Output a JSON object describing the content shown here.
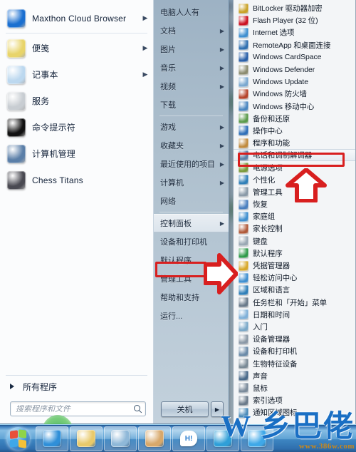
{
  "desktop": {
    "background_color": "#9db4c6"
  },
  "start_menu": {
    "pinned_programs": [
      {
        "label": "Maxthon Cloud Browser",
        "icon": "maxthon-icon",
        "has_submenu": true
      },
      {
        "label": "便笺",
        "icon": "sticky-notes-icon",
        "has_submenu": true
      },
      {
        "label": "记事本",
        "icon": "notepad-icon",
        "has_submenu": true
      },
      {
        "label": "服务",
        "icon": "services-icon",
        "has_submenu": false
      },
      {
        "label": "命令提示符",
        "icon": "command-prompt-icon",
        "has_submenu": false
      },
      {
        "label": "计算机管理",
        "icon": "computer-management-icon",
        "has_submenu": false
      },
      {
        "label": "Chess Titans",
        "icon": "chess-titans-icon",
        "has_submenu": false
      }
    ],
    "all_programs_label": "所有程序",
    "search": {
      "placeholder": "搜索程序和文件",
      "value": "",
      "icon": "search-icon"
    },
    "places": [
      {
        "label": "电脑人人有",
        "has_submenu": false,
        "highlight": false
      },
      {
        "label": "文档",
        "has_submenu": true,
        "highlight": false
      },
      {
        "label": "图片",
        "has_submenu": true,
        "highlight": false
      },
      {
        "label": "音乐",
        "has_submenu": true,
        "highlight": false
      },
      {
        "label": "视频",
        "has_submenu": true,
        "highlight": false
      },
      {
        "label": "下载",
        "has_submenu": false,
        "highlight": false
      },
      {
        "label": "游戏",
        "has_submenu": true,
        "highlight": false
      },
      {
        "label": "收藏夹",
        "has_submenu": true,
        "highlight": false
      },
      {
        "label": "最近使用的项目",
        "has_submenu": true,
        "highlight": false
      },
      {
        "label": "计算机",
        "has_submenu": true,
        "highlight": false
      },
      {
        "label": "网络",
        "has_submenu": false,
        "highlight": false
      },
      {
        "label": "控制面板",
        "has_submenu": true,
        "highlight": true
      },
      {
        "label": "设备和打印机",
        "has_submenu": false,
        "highlight": false
      },
      {
        "label": "默认程序",
        "has_submenu": false,
        "highlight": false
      },
      {
        "label": "管理工具",
        "has_submenu": true,
        "highlight": false
      },
      {
        "label": "帮助和支持",
        "has_submenu": false,
        "highlight": false
      },
      {
        "label": "运行...",
        "has_submenu": false,
        "highlight": false
      }
    ],
    "shutdown": {
      "label": "关机",
      "more_icon": "chevron-right-icon"
    }
  },
  "control_panel_submenu": {
    "items": [
      {
        "label": "BitLocker 驱动器加密",
        "icon": "bitlocker-icon",
        "icon_color": "#c9a227",
        "selected": false
      },
      {
        "label": "Flash Player (32 位)",
        "icon": "flash-player-icon",
        "icon_color": "#cc1122",
        "selected": false
      },
      {
        "label": "Internet 选项",
        "icon": "internet-options-icon",
        "icon_color": "#3f8fd0",
        "selected": false
      },
      {
        "label": "RemoteApp 和桌面连接",
        "icon": "remoteapp-icon",
        "icon_color": "#2f6fb0",
        "selected": false
      },
      {
        "label": "Windows CardSpace",
        "icon": "cardspace-icon",
        "icon_color": "#2a5fa8",
        "selected": false
      },
      {
        "label": "Windows Defender",
        "icon": "defender-icon",
        "icon_color": "#8c8c70",
        "selected": false
      },
      {
        "label": "Windows Update",
        "icon": "windows-update-icon",
        "icon_color": "#7aa8d0",
        "selected": false
      },
      {
        "label": "Windows 防火墙",
        "icon": "firewall-icon",
        "icon_color": "#b5432a",
        "selected": false
      },
      {
        "label": "Windows 移动中心",
        "icon": "mobility-center-icon",
        "icon_color": "#4a86c0",
        "selected": false
      },
      {
        "label": "备份和还原",
        "icon": "backup-restore-icon",
        "icon_color": "#5a9a4a",
        "selected": false
      },
      {
        "label": "操作中心",
        "icon": "action-center-icon",
        "icon_color": "#2f6fb8",
        "selected": false
      },
      {
        "label": "程序和功能",
        "icon": "programs-features-icon",
        "icon_color": "#c08a3e",
        "selected": false
      },
      {
        "label": "电话和调制解调器",
        "icon": "phone-modem-icon",
        "icon_color": "#5b7fa8",
        "selected": true
      },
      {
        "label": "电源选项",
        "icon": "power-options-icon",
        "icon_color": "#7a9a3a",
        "selected": false
      },
      {
        "label": "个性化",
        "icon": "personalization-icon",
        "icon_color": "#2f7fb8",
        "selected": false
      },
      {
        "label": "管理工具",
        "icon": "administrative-tools-icon",
        "icon_color": "#8a9aa8",
        "selected": false
      },
      {
        "label": "恢复",
        "icon": "recovery-icon",
        "icon_color": "#4a7fbf",
        "selected": false
      },
      {
        "label": "家庭组",
        "icon": "homegroup-icon",
        "icon_color": "#3f8fcf",
        "selected": false
      },
      {
        "label": "家长控制",
        "icon": "parental-controls-icon",
        "icon_color": "#b05a3a",
        "selected": false
      },
      {
        "label": "键盘",
        "icon": "keyboard-icon",
        "icon_color": "#9aa8b4",
        "selected": false
      },
      {
        "label": "默认程序",
        "icon": "default-programs-icon",
        "icon_color": "#2f9a4a",
        "selected": false
      },
      {
        "label": "凭据管理器",
        "icon": "credential-manager-icon",
        "icon_color": "#d8a82a",
        "selected": false
      },
      {
        "label": "轻松访问中心",
        "icon": "ease-of-access-icon",
        "icon_color": "#3f8fd0",
        "selected": false
      },
      {
        "label": "区域和语言",
        "icon": "region-language-icon",
        "icon_color": "#2f7fb8",
        "selected": false
      },
      {
        "label": "任务栏和「开始」菜单",
        "icon": "taskbar-startmenu-icon",
        "icon_color": "#6a7a8a",
        "selected": false
      },
      {
        "label": "日期和时间",
        "icon": "date-time-icon",
        "icon_color": "#7fb0d8",
        "selected": false
      },
      {
        "label": "入门",
        "icon": "getting-started-icon",
        "icon_color": "#7aa8c8",
        "selected": false
      },
      {
        "label": "设备管理器",
        "icon": "device-manager-icon",
        "icon_color": "#8a98a6",
        "selected": false
      },
      {
        "label": "设备和打印机",
        "icon": "devices-printers-icon",
        "icon_color": "#6a8aa8",
        "selected": false
      },
      {
        "label": "生物特征设备",
        "icon": "biometric-devices-icon",
        "icon_color": "#7a8a96",
        "selected": false
      },
      {
        "label": "声音",
        "icon": "sound-icon",
        "icon_color": "#4a6a8a",
        "selected": false
      },
      {
        "label": "鼠标",
        "icon": "mouse-icon",
        "icon_color": "#7a8a9a",
        "selected": false
      },
      {
        "label": "索引选项",
        "icon": "indexing-options-icon",
        "icon_color": "#6a7a8a",
        "selected": false
      },
      {
        "label": "通知区域图标",
        "icon": "notification-area-icon",
        "icon_color": "#4a8ab8",
        "selected": false
      }
    ]
  },
  "annotations": {
    "highlight_color": "#d81f1f",
    "boxes": [
      {
        "name": "phone-modem-highlight",
        "target": "电话和调制解调器"
      },
      {
        "name": "control-panel-highlight",
        "target": "控制面板"
      }
    ],
    "arrows": [
      {
        "name": "up-arrow-phone-modem",
        "direction": "up"
      },
      {
        "name": "right-arrow-control-panel",
        "direction": "right"
      }
    ]
  },
  "taskbar": {
    "start_orb": {
      "name": "start-orb",
      "label": "开始"
    },
    "buttons": [
      {
        "name": "taskbar-internet-explorer",
        "icon": "internet-explorer-icon"
      },
      {
        "name": "taskbar-windows-explorer",
        "icon": "folder-icon"
      },
      {
        "name": "taskbar-media-player",
        "icon": "media-player-icon"
      },
      {
        "name": "taskbar-paint",
        "icon": "paint-icon"
      },
      {
        "name": "taskbar-hi-app",
        "icon": "hi-chat-icon",
        "badge": "H!"
      },
      {
        "name": "taskbar-skype",
        "icon": "skype-icon"
      },
      {
        "name": "taskbar-browser",
        "icon": "browser-icon"
      }
    ]
  },
  "watermark": {
    "text": "W 乡巴佬",
    "url": "www.386w.com"
  }
}
